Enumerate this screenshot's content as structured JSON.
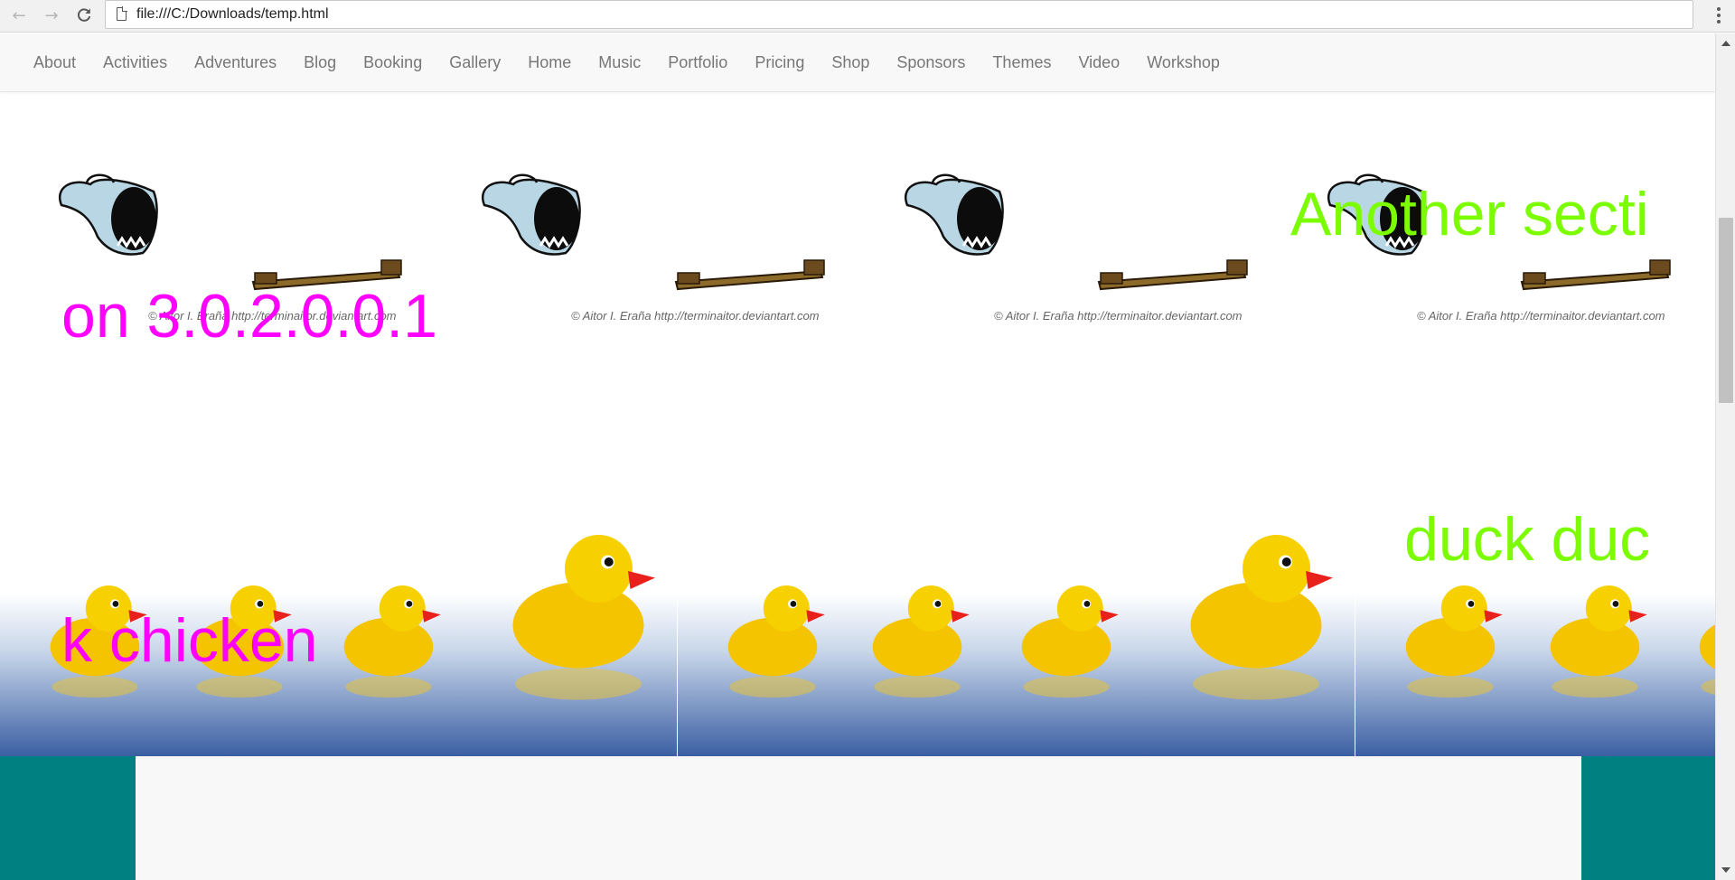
{
  "browser": {
    "url": "file:///C:/Downloads/temp.html",
    "back_icon": "back-arrow-icon",
    "forward_icon": "forward-arrow-icon",
    "reload_icon": "reload-icon",
    "page_icon": "page-icon",
    "menu_icon": "more-vert-icon"
  },
  "nav": {
    "items": [
      "About",
      "Activities",
      "Adventures",
      "Blog",
      "Booking",
      "Gallery",
      "Home",
      "Music",
      "Portfolio",
      "Pricing",
      "Shop",
      "Sponsors",
      "Themes",
      "Video",
      "Workshop"
    ]
  },
  "sections": {
    "ghost": {
      "title_right": "Another secti",
      "title_left": "on 3.0.2.0.0.1",
      "credit_name": "Aitor I. Eraña",
      "credit_url": "http://terminaitor.deviantart.com",
      "credit_symbol": "©"
    },
    "ducks": {
      "title_right": "duck duc",
      "title_left": "k chicken"
    }
  },
  "colors": {
    "title_green": "#7cfc00",
    "title_magenta": "#ff00ff",
    "teal": "#008080",
    "nav_text": "#777777"
  }
}
